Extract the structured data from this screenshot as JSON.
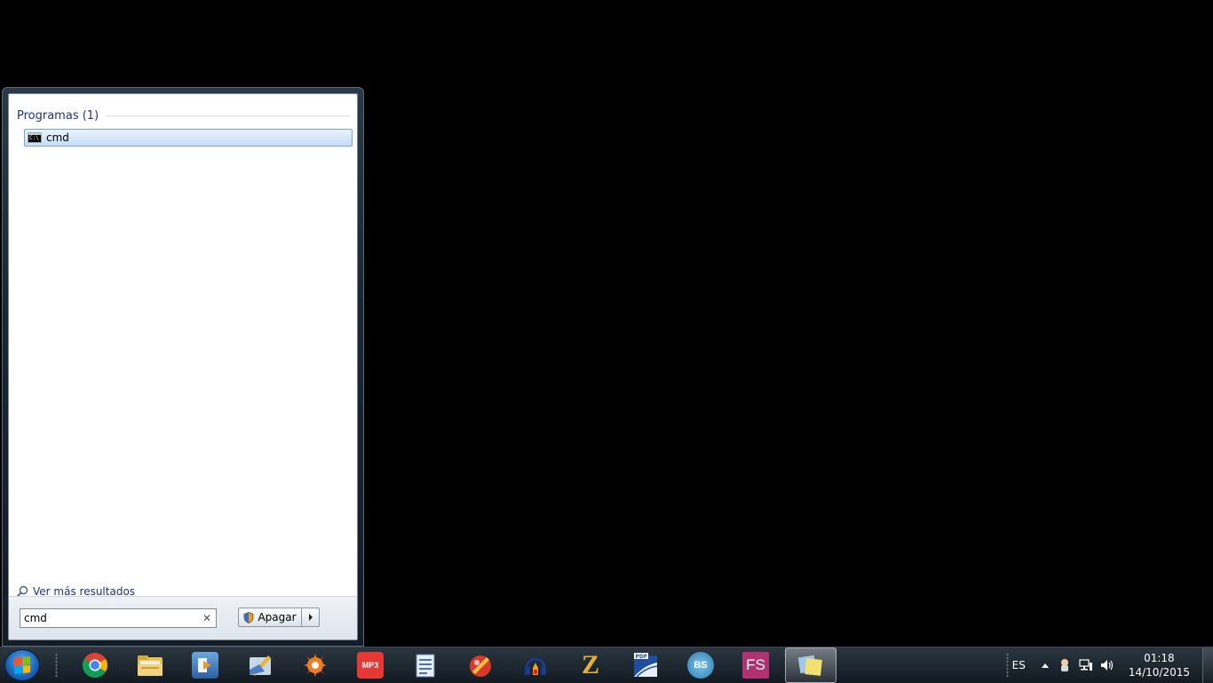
{
  "start_menu": {
    "group_title": "Programas (1)",
    "results": [
      {
        "label": "cmd",
        "icon": "command-prompt-icon"
      }
    ],
    "see_more_label": "Ver más resultados",
    "search": {
      "value": "cmd"
    },
    "shutdown": {
      "label": "Apagar"
    }
  },
  "taskbar": {
    "pinned": [
      {
        "name": "chrome",
        "icon": "chrome-icon"
      },
      {
        "name": "file-explorer",
        "icon": "folder-icon"
      },
      {
        "name": "media-player",
        "icon": "media-player-icon"
      },
      {
        "name": "app-4",
        "icon": "pen-app-icon"
      },
      {
        "name": "avast",
        "icon": "avast-icon"
      },
      {
        "name": "mp3-app",
        "icon": "mp3-icon",
        "text": "MP3"
      },
      {
        "name": "document-app",
        "icon": "document-icon"
      },
      {
        "name": "app-8",
        "icon": "paint-icon"
      },
      {
        "name": "audio-app",
        "icon": "audio-icon"
      },
      {
        "name": "z-app",
        "icon": "z-icon",
        "text": "Z"
      },
      {
        "name": "pdf-app",
        "icon": "pdf-icon",
        "text": "PDF"
      },
      {
        "name": "bs-app",
        "icon": "bs-icon",
        "text": "BS"
      },
      {
        "name": "fs-app",
        "icon": "fs-icon",
        "text": "FS"
      },
      {
        "name": "notes-app",
        "icon": "notes-icon"
      }
    ],
    "tray": {
      "language": "ES",
      "time": "01:18",
      "date": "14/10/2015"
    }
  },
  "colors": {
    "accent_text": "#1e3287",
    "selection_border": "#7da2ce"
  }
}
